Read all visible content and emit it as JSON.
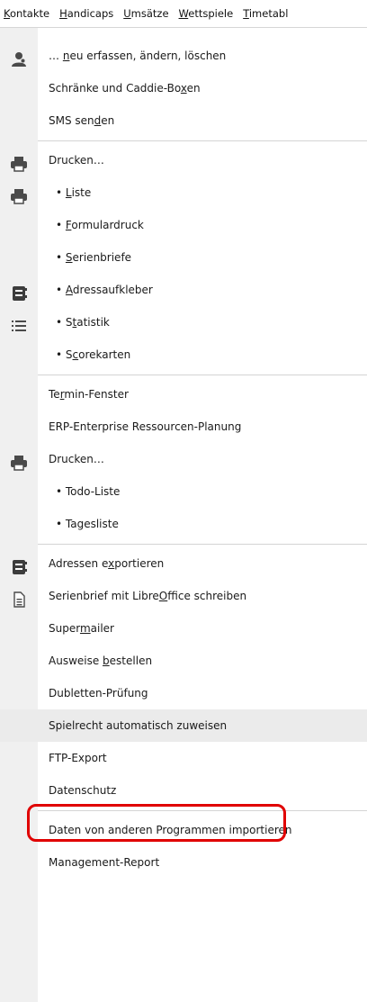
{
  "menubar": {
    "items": [
      {
        "key": "K",
        "rest": "ontakte"
      },
      {
        "key": "H",
        "rest": "andicaps"
      },
      {
        "key": "U",
        "rest": "msätze"
      },
      {
        "key": "W",
        "rest": "ettspiele"
      },
      {
        "key": "T",
        "rest": "imetabl"
      }
    ]
  },
  "menu": {
    "items": [
      {
        "pre": "… ",
        "key": "n",
        "post": "eu erfassen, ändern, löschen",
        "icon": "person-icon"
      },
      {
        "pre": "Schränke und Caddie-Bo",
        "key": "x",
        "post": "en"
      },
      {
        "pre": "SMS sen",
        "key": "d",
        "post": "en"
      },
      {
        "pre": "Drucken…",
        "key": "",
        "post": "",
        "icon": "printer-icon"
      },
      {
        "pre": "• ",
        "key": "L",
        "post": "iste",
        "icon": "printer-icon"
      },
      {
        "pre": "• ",
        "key": "F",
        "post": "ormulardruck"
      },
      {
        "pre": "• ",
        "key": "S",
        "post": "erienbriefe"
      },
      {
        "pre": "• ",
        "key": "A",
        "post": "dressaufkleber",
        "icon": "address-book-icon"
      },
      {
        "pre": "• S",
        "key": "t",
        "post": "atistik",
        "icon": "list-icon"
      },
      {
        "pre": "• S",
        "key": "c",
        "post": "orekarten"
      },
      {
        "pre": "Te",
        "key": "r",
        "post": "min-Fenster"
      },
      {
        "pre": "ERP-Enterprise Ressourcen-Planung",
        "key": "",
        "post": ""
      },
      {
        "pre": "Drucken…",
        "key": "",
        "post": "",
        "icon": "printer-icon"
      },
      {
        "pre": "• Todo-Liste",
        "key": "",
        "post": ""
      },
      {
        "pre": "• Tagesliste",
        "key": "",
        "post": ""
      },
      {
        "pre": "Adressen e",
        "key": "x",
        "post": "portieren",
        "icon": "address-book-icon"
      },
      {
        "pre": "Serienbrief mit Libre",
        "key": "O",
        "post": "ffice schreiben",
        "icon": "document-icon"
      },
      {
        "pre": "Super",
        "key": "m",
        "post": "ailer"
      },
      {
        "pre": "Ausweise ",
        "key": "b",
        "post": "estellen"
      },
      {
        "pre": "Dubletten-Prüfung",
        "key": "",
        "post": ""
      },
      {
        "pre": "Spielrecht automatisch zuweisen",
        "key": "",
        "post": ""
      },
      {
        "pre": "FTP-Export",
        "key": "",
        "post": ""
      },
      {
        "pre": "Datenschutz",
        "key": "",
        "post": ""
      },
      {
        "pre": "Daten von anderen Programmen importieren",
        "key": "",
        "post": ""
      },
      {
        "pre": "Management-Report",
        "key": "",
        "post": ""
      }
    ],
    "highlighted_index": 20
  },
  "colors": {
    "highlight_ring": "#e00000",
    "hover_row": "#ebebeb",
    "gutter": "#f0f0f0",
    "icon": "#4a4a4a"
  }
}
